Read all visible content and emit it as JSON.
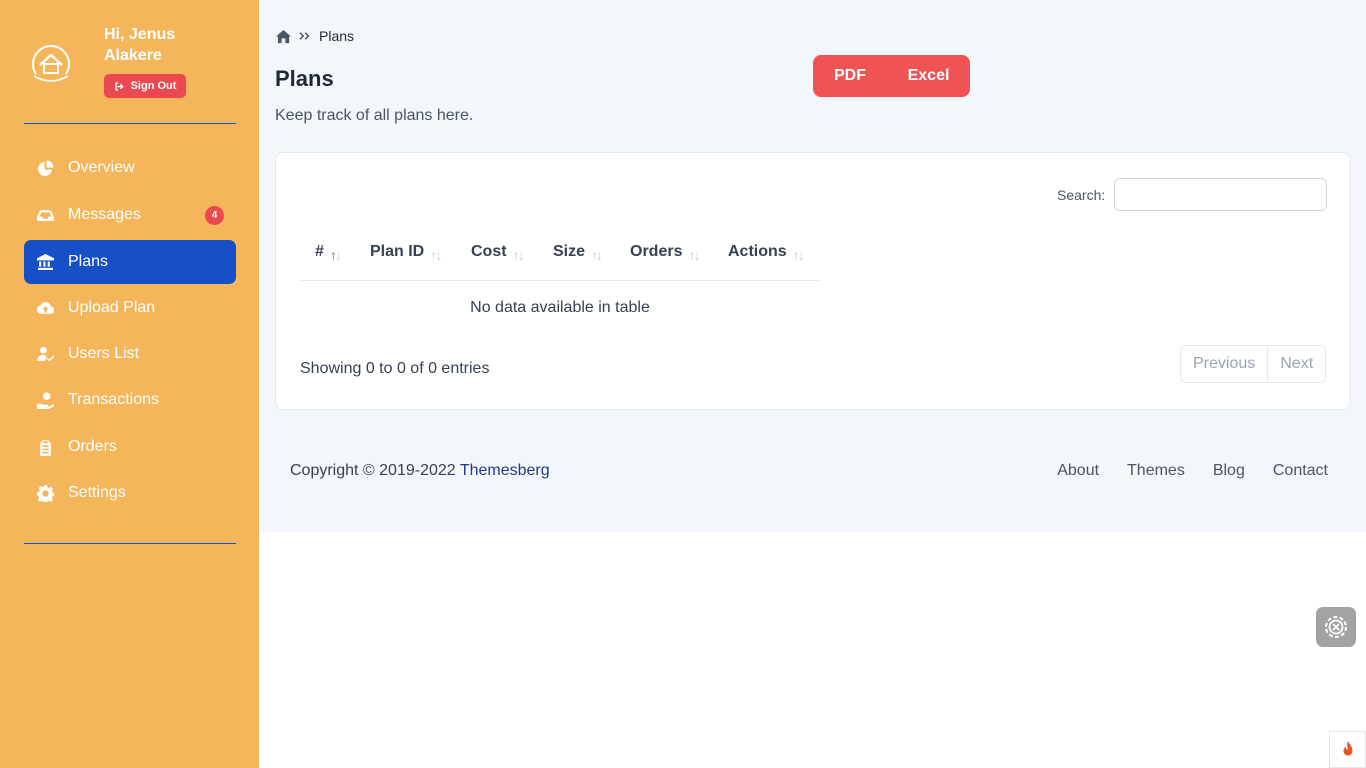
{
  "user": {
    "greeting": "Hi, Jenus Alakere",
    "signout_label": "Sign Out"
  },
  "sidebar": {
    "items": [
      {
        "label": "Overview",
        "icon": "pie-chart-icon"
      },
      {
        "label": "Messages",
        "icon": "inbox-icon",
        "badge": "4"
      },
      {
        "label": "Plans",
        "icon": "bank-icon",
        "active": true
      },
      {
        "label": "Upload Plan",
        "icon": "cloud-upload-icon"
      },
      {
        "label": "Users List",
        "icon": "user-check-icon"
      },
      {
        "label": "Transactions",
        "icon": "hand-holding-dollar-icon"
      },
      {
        "label": "Orders",
        "icon": "clipboard-list-icon"
      },
      {
        "label": "Settings",
        "icon": "gear-icon"
      }
    ]
  },
  "breadcrumb": {
    "current": "Plans"
  },
  "page": {
    "title": "Plans",
    "subtitle": "Keep track of all plans here."
  },
  "export": {
    "pdf": "PDF",
    "excel": "Excel"
  },
  "table": {
    "search_label": "Search:",
    "columns": [
      "#",
      "Plan ID",
      "Cost",
      "Size",
      "Orders",
      "Actions"
    ],
    "empty_message": "No data available in table",
    "info": "Showing 0 to 0 of 0 entries",
    "pagination": {
      "previous": "Previous",
      "next": "Next"
    }
  },
  "footer": {
    "copyright": "Copyright © 2019-2022 ",
    "brand": "Themesberg",
    "links": [
      "About",
      "Themes",
      "Blog",
      "Contact"
    ]
  },
  "colors": {
    "sidebar_bg": "#f5b65b",
    "active_item": "#1650c6",
    "accent_red": "#ef5354",
    "main_bg": "#f3f6fa"
  }
}
